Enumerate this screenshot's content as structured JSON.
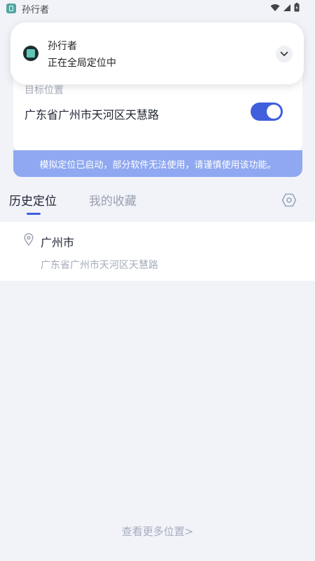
{
  "status_bar": {
    "app_name": "孙行者"
  },
  "notification": {
    "title": "孙行者",
    "text": "正在全局定位中"
  },
  "target_card": {
    "label": "目标位置",
    "address": "广东省广州市天河区天慧路",
    "toggle_on": true
  },
  "warning": {
    "text": "模拟定位已启动，部分软件无法使用，请谨慎使用该功能。"
  },
  "tabs": [
    {
      "label": "历史定位",
      "active": true
    },
    {
      "label": "我的收藏",
      "active": false
    }
  ],
  "history": [
    {
      "city": "广州市",
      "address": "广东省广州市天河区天慧路"
    }
  ],
  "more_link": "查看更多位置>",
  "colors": {
    "accent": "#3f5fdc",
    "warning_bg": "#8fa8f1",
    "page_bg": "#f1f3f9"
  }
}
